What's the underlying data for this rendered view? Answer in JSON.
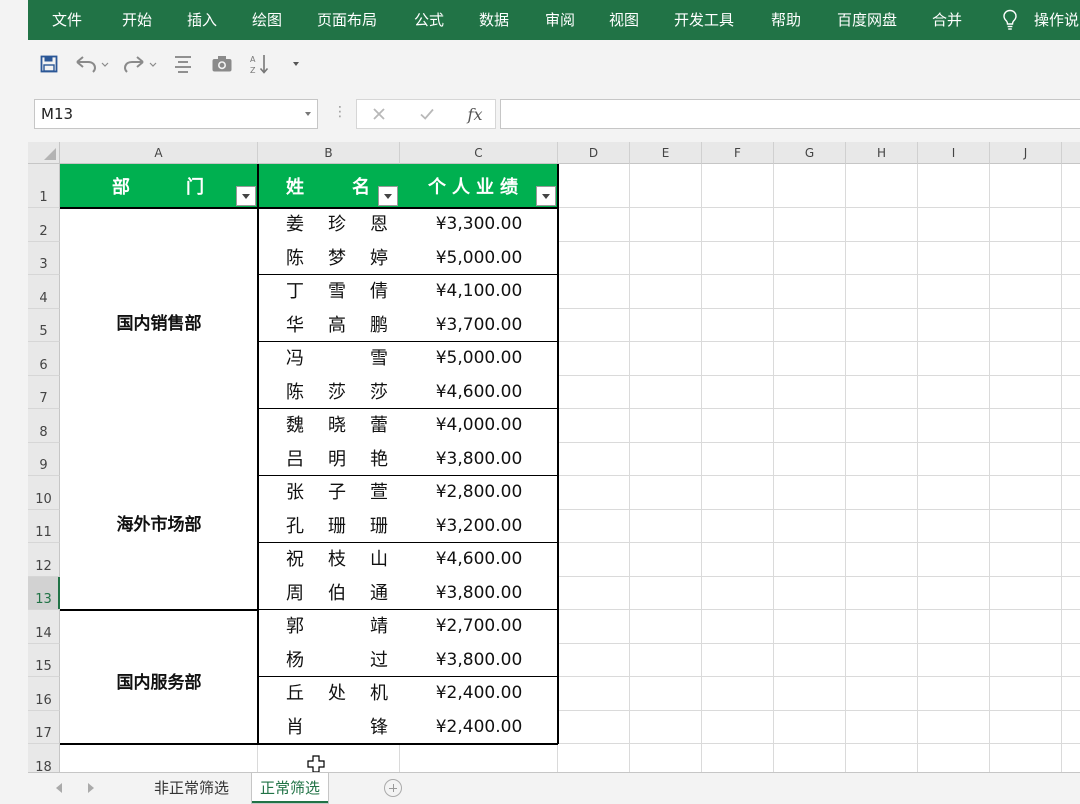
{
  "ribbon": {
    "tabs": [
      "文件",
      "开始",
      "插入",
      "绘图",
      "页面布局",
      "公式",
      "数据",
      "审阅",
      "视图",
      "开发工具",
      "帮助",
      "百度网盘",
      "合并"
    ],
    "tell_me": "操作说"
  },
  "quick_access": {
    "icons": [
      "save-icon",
      "undo-icon",
      "redo-icon",
      "align-icon",
      "camera-icon",
      "sort-icon",
      "customize-icon"
    ]
  },
  "formula_bar": {
    "name_box": "M13",
    "formula": "",
    "fx_label": "fx"
  },
  "grid": {
    "columns": [
      "A",
      "B",
      "C",
      "D",
      "E",
      "F",
      "G",
      "H",
      "I",
      "J"
    ],
    "rows": [
      "1",
      "2",
      "3",
      "4",
      "5",
      "6",
      "7",
      "8",
      "9",
      "10",
      "11",
      "12",
      "13",
      "14",
      "15",
      "16",
      "17",
      "18"
    ],
    "active_cell": "M13"
  },
  "table": {
    "headers": [
      {
        "label": "部",
        "label2": "门"
      },
      {
        "label": "姓",
        "label2": "名"
      },
      {
        "label": "个人业绩"
      }
    ],
    "departments": [
      "国内销售部",
      "海外市场部",
      "国内服务部"
    ],
    "records": [
      {
        "name": [
          "姜",
          "珍",
          "恩"
        ],
        "perf": "¥3,300.00"
      },
      {
        "name": [
          "陈",
          "梦",
          "婷"
        ],
        "perf": "¥5,000.00"
      },
      {
        "name": [
          "丁",
          "雪",
          "倩"
        ],
        "perf": "¥4,100.00"
      },
      {
        "name": [
          "华",
          "高",
          "鹏"
        ],
        "perf": "¥3,700.00"
      },
      {
        "name": [
          "冯",
          "",
          "雪"
        ],
        "perf": "¥5,000.00"
      },
      {
        "name": [
          "陈",
          "莎",
          "莎"
        ],
        "perf": "¥4,600.00"
      },
      {
        "name": [
          "魏",
          "晓",
          "蕾"
        ],
        "perf": "¥4,000.00"
      },
      {
        "name": [
          "吕",
          "明",
          "艳"
        ],
        "perf": "¥3,800.00"
      },
      {
        "name": [
          "张",
          "子",
          "萱"
        ],
        "perf": "¥2,800.00"
      },
      {
        "name": [
          "孔",
          "珊",
          "珊"
        ],
        "perf": "¥3,200.00"
      },
      {
        "name": [
          "祝",
          "枝",
          "山"
        ],
        "perf": "¥4,600.00"
      },
      {
        "name": [
          "周",
          "伯",
          "通"
        ],
        "perf": "¥3,800.00"
      },
      {
        "name": [
          "郭",
          "",
          "靖"
        ],
        "perf": "¥2,700.00"
      },
      {
        "name": [
          "杨",
          "",
          "过"
        ],
        "perf": "¥3,800.00"
      },
      {
        "name": [
          "丘",
          "处",
          "机"
        ],
        "perf": "¥2,400.00"
      },
      {
        "name": [
          "肖",
          "",
          "锋"
        ],
        "perf": "¥2,400.00"
      }
    ]
  },
  "sheets": {
    "tabs": [
      "非正常筛选",
      "正常筛选"
    ],
    "active": "正常筛选"
  },
  "colors": {
    "ribbon": "#217346",
    "header_fill": "#00b050"
  }
}
